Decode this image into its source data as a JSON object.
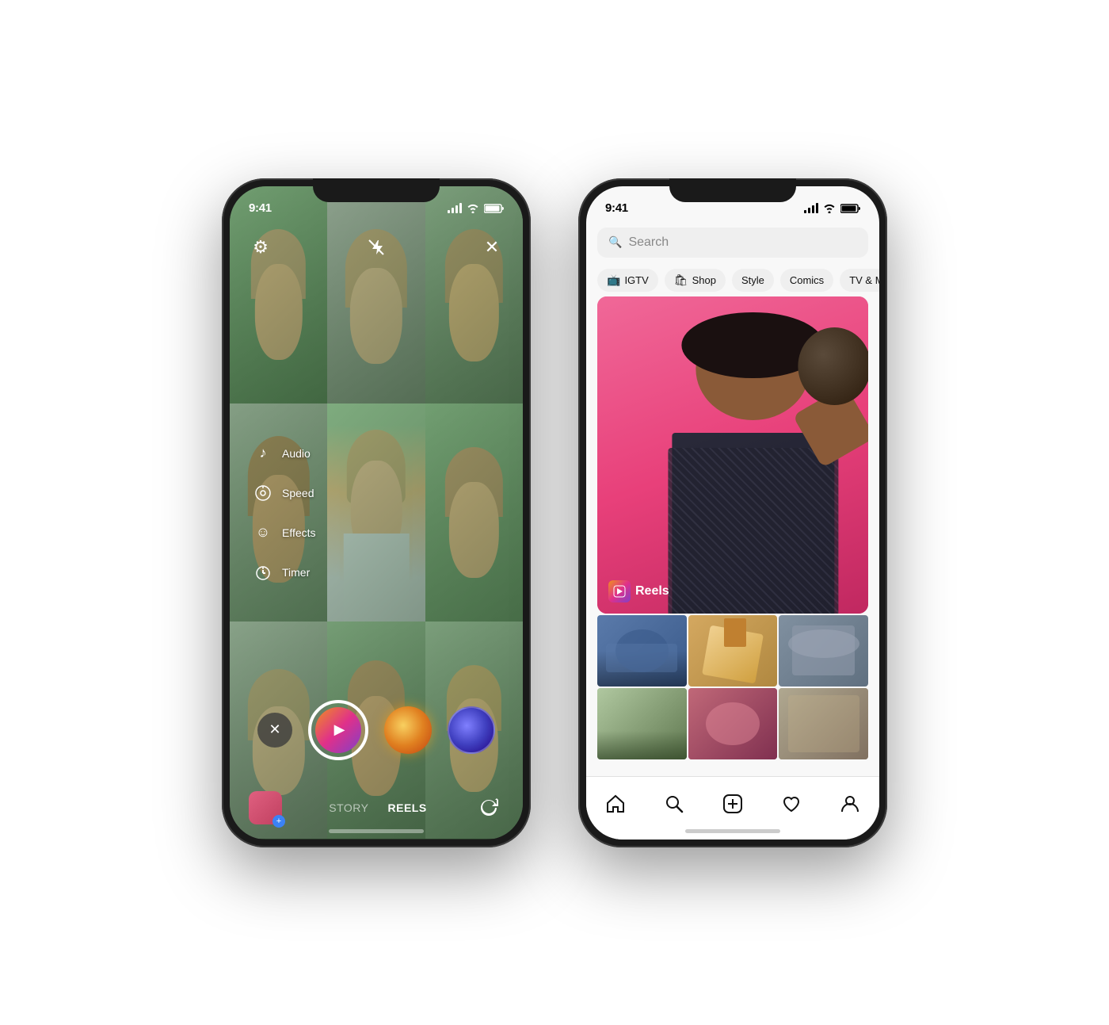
{
  "page": {
    "bg_color": "#ffffff"
  },
  "left_phone": {
    "status_bar": {
      "time": "9:41",
      "signal_icon": "signal-icon",
      "wifi_icon": "wifi-icon",
      "battery_icon": "battery-icon"
    },
    "camera": {
      "settings_icon": "settings-icon",
      "flash_icon": "flash-x-icon",
      "close_icon": "close-icon",
      "menu_items": [
        {
          "icon": "♪",
          "icon_name": "audio-icon",
          "label": "Audio"
        },
        {
          "icon": "◎",
          "icon_name": "speed-icon",
          "label": "Speed"
        },
        {
          "icon": "☺",
          "icon_name": "effects-icon",
          "label": "Effects"
        },
        {
          "icon": "◷",
          "icon_name": "timer-icon",
          "label": "Timer"
        }
      ]
    },
    "bottom_bar": {
      "story_label": "STORY",
      "reels_label": "REELS"
    }
  },
  "right_phone": {
    "status_bar": {
      "time": "9:41",
      "signal_icon": "signal-icon",
      "wifi_icon": "wifi-icon",
      "battery_icon": "battery-icon"
    },
    "search": {
      "placeholder": "Search"
    },
    "categories": [
      {
        "icon": "📺",
        "label": "IGTV"
      },
      {
        "icon": "🛍",
        "label": "Shop"
      },
      {
        "icon": "",
        "label": "Style"
      },
      {
        "icon": "",
        "label": "Comics"
      },
      {
        "icon": "",
        "label": "TV & Movie"
      }
    ],
    "featured": {
      "reels_label": "Reels"
    },
    "nav": {
      "home_icon": "home-icon",
      "search_icon": "search-icon",
      "add_icon": "add-icon",
      "heart_icon": "heart-icon",
      "profile_icon": "profile-icon"
    }
  }
}
